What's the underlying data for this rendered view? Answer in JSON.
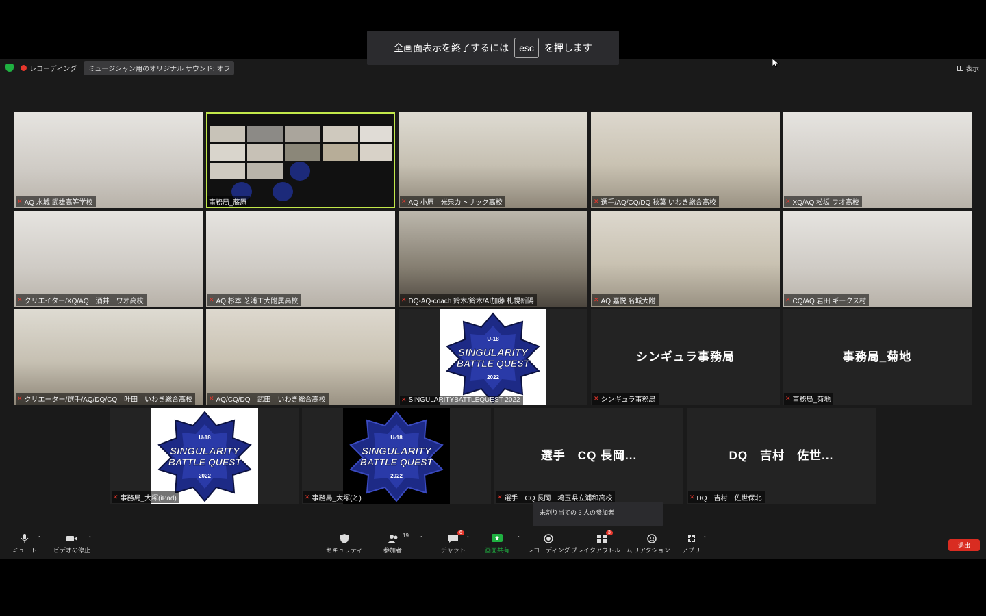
{
  "fullscreen_banner": {
    "prefix": "全画面表示を終了するには",
    "key": "esc",
    "suffix": "を押します"
  },
  "topbar": {
    "recording": "レコーディング",
    "sound": "ミュージシャン用のオリジナル サウンド: オフ",
    "view": "表示"
  },
  "tiles": [
    {
      "name": "AQ 水城 武雄高等学校",
      "type": "camera"
    },
    {
      "name": "事務局_藤原",
      "type": "screenshare",
      "active": true
    },
    {
      "name": "AQ 小原　光泉カトリック高校",
      "type": "camera"
    },
    {
      "name": "選手/AQ/CQ/DQ 秋葉 いわき総合高校",
      "type": "camera"
    },
    {
      "name": "XQ/AQ 松坂 ワオ高校",
      "type": "camera"
    },
    {
      "name": "クリエイター/XQ/AQ　酒井　ワオ高校",
      "type": "camera"
    },
    {
      "name": "AQ 杉本 芝浦工大附属高校",
      "type": "camera"
    },
    {
      "name": "DQ-AQ-coach 鈴木/鈴木/AI加藤 札幌新陽",
      "type": "camera"
    },
    {
      "name": "AQ 嘉悦 名城大附",
      "type": "camera"
    },
    {
      "name": "CQ/AQ 岩田 ギークス村",
      "type": "camera"
    },
    {
      "name": "クリエーター/選手/AQ/DQ/CQ　叶田　いわき総合高校",
      "type": "camera"
    },
    {
      "name": "AQ/CQ/DQ　武田　いわき総合高校",
      "type": "camera"
    },
    {
      "name": "SINGULARITYBATTLEQUEST 2022",
      "type": "logo"
    },
    {
      "name": "シンギュラ事務局",
      "big": "シンギュラ事務局",
      "type": "name"
    },
    {
      "name": "事務局_菊地",
      "big": "事務局_菊地",
      "type": "name"
    },
    {
      "name": "事務局_大塚(iPad)",
      "type": "logo"
    },
    {
      "name": "事務局_大塚(と)",
      "type": "logo-dark"
    },
    {
      "name": "選手　CQ 長岡　埼玉県立浦和高校",
      "big": "選手　CQ 長岡...",
      "type": "name"
    },
    {
      "name": "DQ　吉村　佐世保北",
      "big": "DQ　吉村　佐世...",
      "type": "name"
    }
  ],
  "logo": {
    "top": "U-18",
    "line1": "SINGULARITY",
    "line2": "BATTLE QUEST",
    "year": "2022"
  },
  "unassigned_tip": "未割り当ての 3 人の参加者",
  "toolbar": {
    "mute": "ミュート",
    "video": "ビデオの停止",
    "security": "セキュリティ",
    "participants": "参加者",
    "participants_count": "19",
    "chat": "チャット",
    "chat_badge": "6",
    "share": "画面共有",
    "record": "レコーディング",
    "breakout": "ブレイクアウトルーム",
    "breakout_badge": "3",
    "reactions": "リアクション",
    "apps": "アプリ",
    "leave": "退出"
  },
  "colors": {
    "active_border": "#c2e84a",
    "leave": "#d92c21",
    "share": "#1fb141"
  }
}
